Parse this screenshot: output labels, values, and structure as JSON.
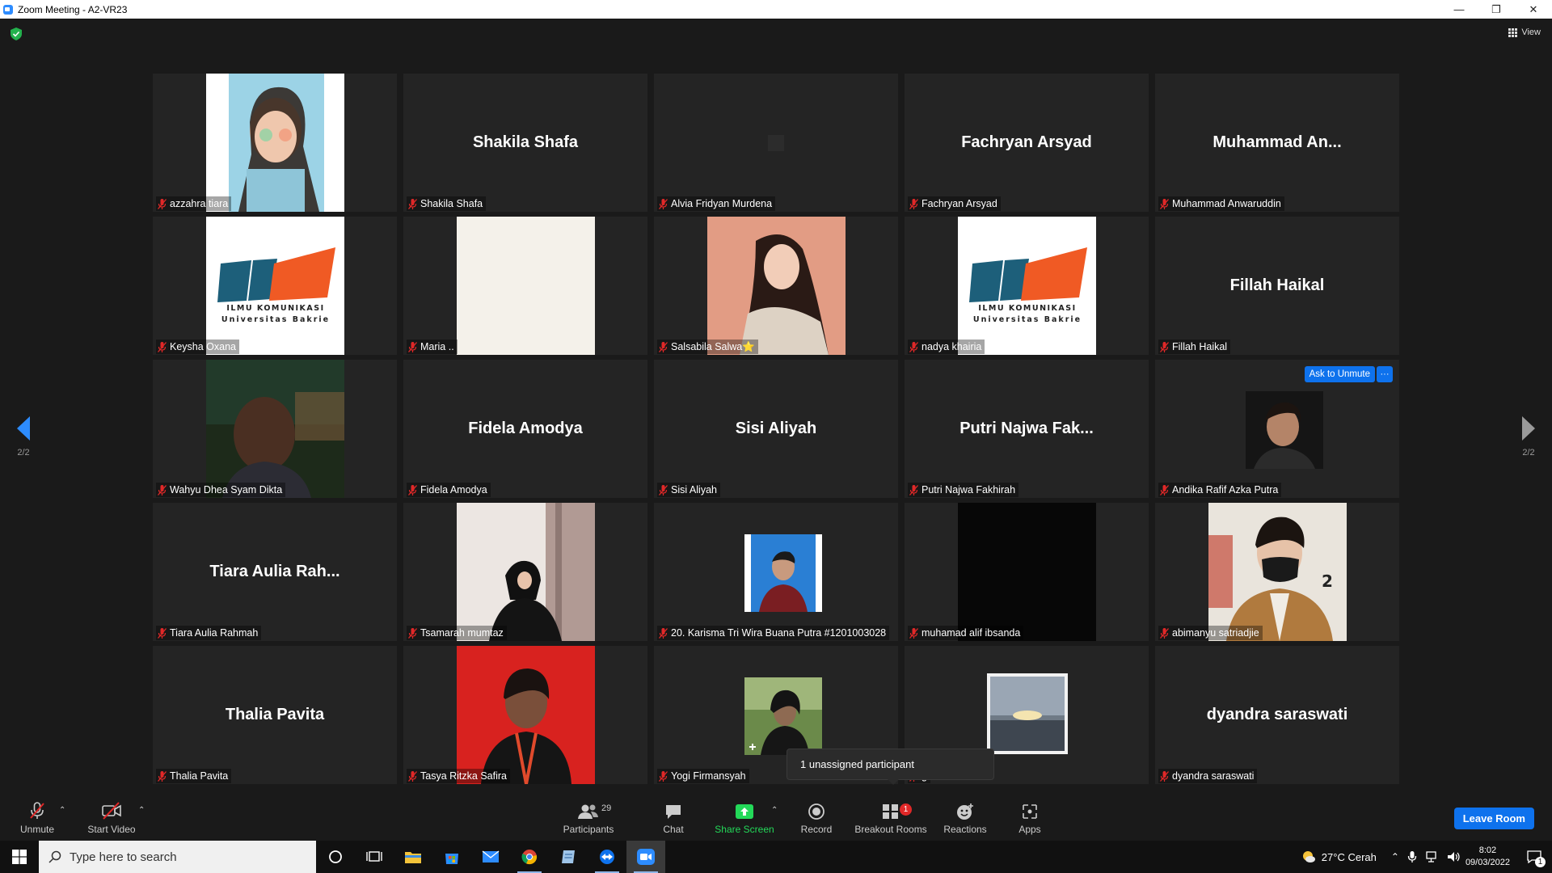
{
  "window": {
    "title": "Zoom Meeting - A2-VR23",
    "minimize": "—",
    "maximize": "❐",
    "close": "✕"
  },
  "view": {
    "label": "View"
  },
  "pager": {
    "left": "2/2",
    "right": "2/2"
  },
  "tiles": [
    {
      "name": "azzahra tiara",
      "display": ""
    },
    {
      "name": "Shakila Shafa",
      "display": "Shakila Shafa"
    },
    {
      "name": "Alvia Fridyan Murdena",
      "display": ""
    },
    {
      "name": "Fachryan Arsyad",
      "display": "Fachryan Arsyad"
    },
    {
      "name": "Muhammad Anwaruddin",
      "display": "Muhammad  An..."
    },
    {
      "name": "Keysha Oxana",
      "display": ""
    },
    {
      "name": "Maria ..",
      "display": ""
    },
    {
      "name": "Salsabila Salwa⭐",
      "display": ""
    },
    {
      "name": "nadya khairia",
      "display": ""
    },
    {
      "name": "Fillah Haikal",
      "display": "Fillah Haikal"
    },
    {
      "name": "Wahyu Dhea Syam Dikta",
      "display": ""
    },
    {
      "name": "Fidela Amodya",
      "display": "Fidela Amodya"
    },
    {
      "name": "Sisi Aliyah",
      "display": "Sisi Aliyah"
    },
    {
      "name": "Putri Najwa Fakhirah",
      "display": "Putri  Najwa  Fak..."
    },
    {
      "name": "Andika Rafif Azka Putra",
      "display": ""
    },
    {
      "name": "Tiara Aulia Rahmah",
      "display": "Tiara  Aulia  Rah..."
    },
    {
      "name": "Tsamarah mumtaz",
      "display": ""
    },
    {
      "name": "20. Karisma Tri Wira Buana Putra #1201003028",
      "display": ""
    },
    {
      "name": "muhamad alif ibsanda",
      "display": ""
    },
    {
      "name": "abimanyu satriadjie",
      "display": ""
    },
    {
      "name": "Thalia Pavita",
      "display": "Thalia Pavita"
    },
    {
      "name": "Tasya Ritzka Safira",
      "display": ""
    },
    {
      "name": "Yogi Firmansyah",
      "display": ""
    },
    {
      "name": "g",
      "display": ""
    },
    {
      "name": "dyandra saraswati",
      "display": "dyandra saraswati"
    }
  ],
  "logo": {
    "line1": "ILMU KOMUNIKASI",
    "line2": "Universitas Bakrie"
  },
  "shirt_number": "2",
  "hover": {
    "ask_unmute": "Ask to Unmute",
    "more": "···"
  },
  "tooltip": "1 unassigned participant",
  "toolbar": {
    "unmute": "Unmute",
    "start_video": "Start Video",
    "participants": "Participants",
    "participants_count": "29",
    "chat": "Chat",
    "share_screen": "Share Screen",
    "record": "Record",
    "breakout_rooms": "Breakout Rooms",
    "breakout_badge": "1",
    "reactions": "Reactions",
    "apps": "Apps",
    "leave": "Leave Room"
  },
  "taskbar": {
    "search_placeholder": "Type here to search",
    "weather": "27°C  Cerah",
    "time": "8:02",
    "date": "09/03/2022",
    "notif_count": "1"
  },
  "colors": {
    "accent": "#0e72ed",
    "share_green": "#23d959",
    "mute_red": "#e02828",
    "tile_bg": "#242424"
  }
}
